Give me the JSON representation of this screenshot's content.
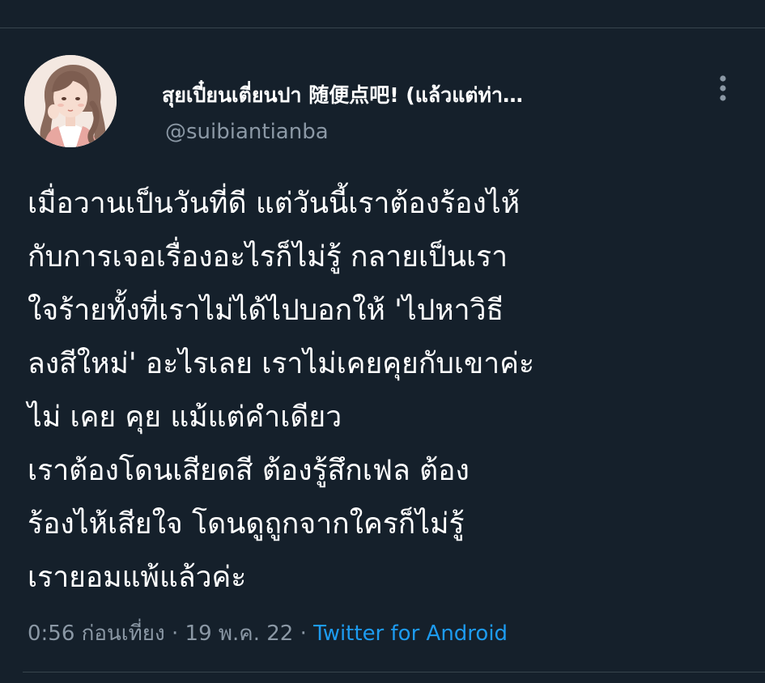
{
  "tweet": {
    "author": {
      "display_name": "สุยเปี๋ยนเตี่ยนปา 随便点吧!  (แล้วแต่ท่า…",
      "handle": "@suibiantianba"
    },
    "text_lines": [
      "เมื่อวานเป็นวันที่ดี แต่วันนี้เราต้องร้องไห้",
      "กับการเจอเรื่องอะไรก็ไม่รู้ กลายเป็นเรา",
      "ใจร้ายทั้งที่เราไม่ได้ไปบอกให้ 'ไปหาวิธี",
      "ลงสีใหม่' อะไรเลย เราไม่เคยคุยกับเขาค่ะ",
      "ไม่ เคย คุย แม้แต่คำเดียว",
      "เราต้องโดนเสียดสี ต้องรู้สึกเฟล ต้อง",
      "ร้องไห้เสียใจ โดนดูถูกจากใครก็ไม่รู้",
      "เรายอมแพ้แล้วค่ะ"
    ],
    "time": "0:56 ก่อนเที่ยง",
    "separator": " · ",
    "date": "19 พ.ค. 22",
    "source": "Twitter for Android"
  },
  "icons": {
    "more": "more-vertical-icon",
    "avatar": "avatar-illustration"
  },
  "colors": {
    "background": "#15202b",
    "secondary_text": "#8b98a5",
    "link": "#1d9bf0",
    "divider": "#38444d"
  }
}
